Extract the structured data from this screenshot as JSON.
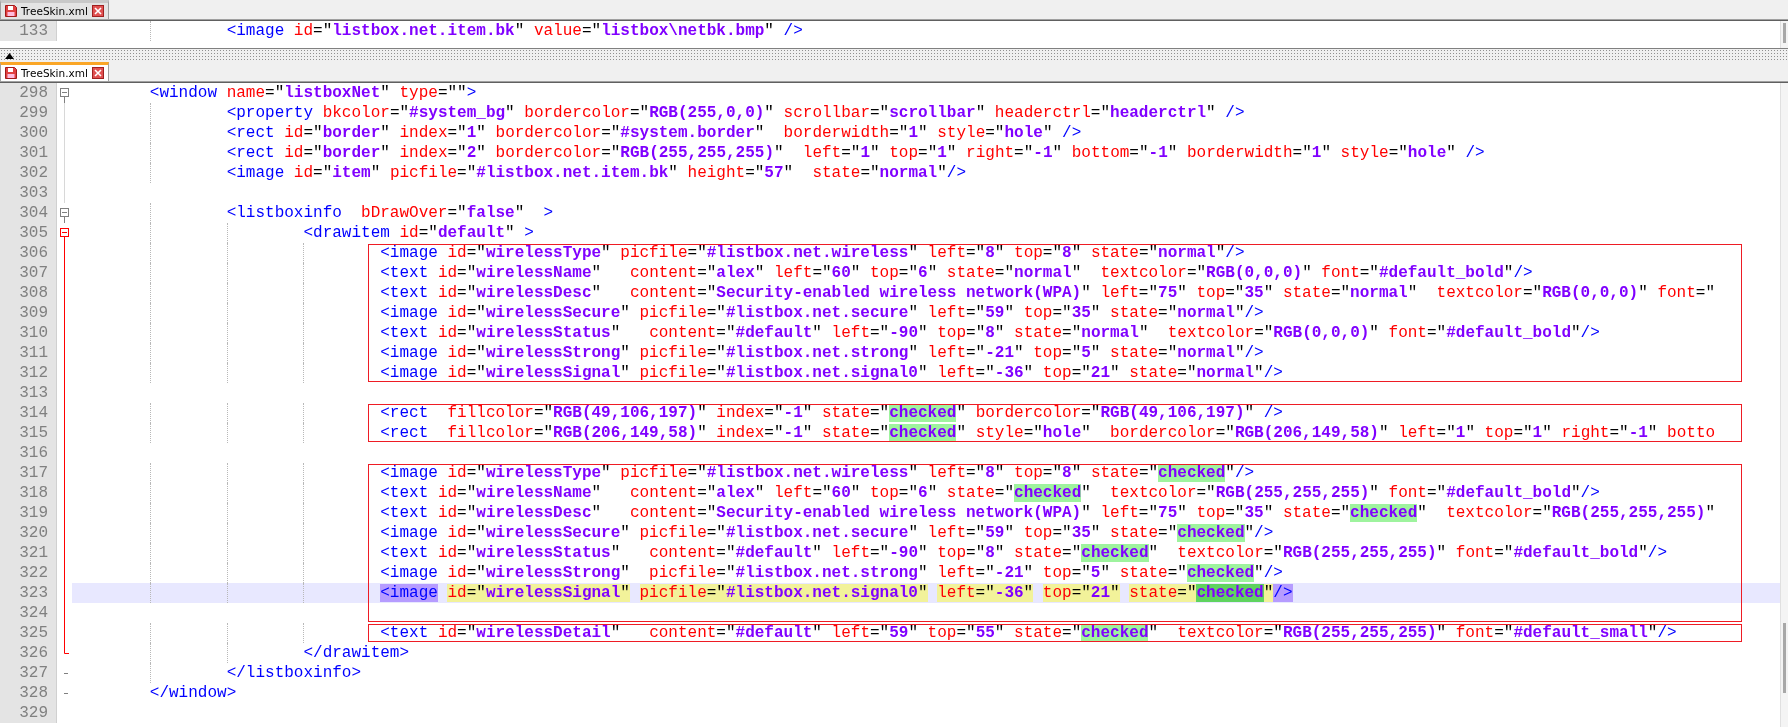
{
  "editors": [
    {
      "tab": {
        "label": "TreeSkin.xml",
        "selected": false
      },
      "blocks": [
        {
          "boxed": false,
          "lines": [
            {
              "number": "133",
              "current": false,
              "kind": "plain",
              "parts": [
                "\t\t<image id=\"listbox.net.item.bk\" value=\"listbox\\netbk.bmp\" />"
              ]
            }
          ]
        }
      ]
    },
    {
      "tab": {
        "label": "TreeSkin.xml",
        "selected": true
      },
      "blocks": [
        {
          "boxed": false,
          "lines": [
            {
              "number": "298",
              "current": false,
              "kind": "open",
              "fold_active": false,
              "parts": [
                "\t<window name=\"listboxNet\" type=\"\">"
              ]
            },
            {
              "number": "299",
              "current": false,
              "kind": "body",
              "fold_active": false,
              "parts": [
                "\t\t<property bkcolor=\"#system_bg\" bordercolor=\"RGB(255,0,0)\" scrollbar=\"scrollbar\" headerctrl=\"headerctrl\" />"
              ]
            },
            {
              "number": "300",
              "current": false,
              "kind": "body",
              "fold_active": false,
              "parts": [
                "\t\t<rect id=\"border\" index=\"1\" bordercolor=\"#system.border\"  borderwidth=\"1\" style=\"hole\" />"
              ]
            },
            {
              "number": "301",
              "current": false,
              "kind": "body",
              "fold_active": false,
              "parts": [
                "\t\t<rect id=\"border\" index=\"2\" bordercolor=\"RGB(255,255,255)\"  left=\"1\" top=\"1\" right=\"-1\" bottom=\"-1\" borderwidth=\"1\" style=\"hole\" />"
              ]
            },
            {
              "number": "302",
              "current": false,
              "kind": "body",
              "fold_active": false,
              "parts": [
                "\t\t<image id=\"item\" picfile=\"#listbox.net.item.bk\" height=\"57\"  state=\"normal\"/>"
              ]
            },
            {
              "number": "303",
              "current": false,
              "kind": "body",
              "fold_active": false
            },
            {
              "number": "304",
              "current": false,
              "kind": "open",
              "fold_active": false,
              "parts": [
                "\t\t<listboxinfo  bDrawOver=\"false\"  >"
              ]
            },
            {
              "number": "305",
              "current": false,
              "kind": "open",
              "fold_active": true,
              "parts": [
                "\t\t\t<drawitem id=\"default\" >"
              ]
            }
          ]
        },
        {
          "boxed": true,
          "lines": [
            {
              "number": "306",
              "current": false,
              "kind": "body",
              "fold_active": true,
              "parts": [
                "\t\t\t\t<image id=\"wirelessType\" picfile=\"#listbox.net.wireless\" left=\"8\" top=\"8\" state=\"normal\"/>"
              ]
            },
            {
              "number": "307",
              "current": false,
              "kind": "body",
              "fold_active": true,
              "parts": [
                "\t\t\t\t<text id=\"wirelessName\"   content=\"alex\" left=\"60\" top=\"6\" state=\"normal\"  textcolor=\"RGB(0,0,0)\" font=\"#default_bold\"/>"
              ]
            },
            {
              "number": "308",
              "current": false,
              "kind": "body",
              "fold_active": true,
              "parts": [
                "\t\t\t\t<text id=\"wirelessDesc\"   content=\"Security-enabled wireless network(WPA)\" left=\"75\" top=\"35\" state=\"normal\"  textcolor=\"RGB(0,0,0)\" font=\""
              ]
            },
            {
              "number": "309",
              "current": false,
              "kind": "body",
              "fold_active": true,
              "parts": [
                "\t\t\t\t<image id=\"wirelessSecure\" picfile=\"#listbox.net.secure\" left=\"59\" top=\"35\" state=\"normal\"/>"
              ]
            },
            {
              "number": "310",
              "current": false,
              "kind": "body",
              "fold_active": true,
              "parts": [
                "\t\t\t\t<text id=\"wirelessStatus\"   content=\"#default\" left=\"-90\" top=\"8\" state=\"normal\"  textcolor=\"RGB(0,0,0)\" font=\"#default_bold\"/>"
              ]
            },
            {
              "number": "311",
              "current": false,
              "kind": "body",
              "fold_active": true,
              "parts": [
                "\t\t\t\t<image id=\"wirelessStrong\" picfile=\"#listbox.net.strong\" left=\"-21\" top=\"5\" state=\"normal\"/>"
              ]
            },
            {
              "number": "312",
              "current": false,
              "kind": "body",
              "fold_active": true,
              "parts": [
                "\t\t\t\t<image id=\"wirelessSignal\" picfile=\"#listbox.net.signal0\" left=\"-36\" top=\"21\" state=\"normal\"/>"
              ]
            }
          ]
        },
        {
          "boxed": false,
          "lines": [
            {
              "number": "313",
              "current": false,
              "kind": "body",
              "fold_active": true
            }
          ]
        },
        {
          "boxed": true,
          "lines": [
            {
              "number": "314",
              "current": false,
              "kind": "body",
              "fold_active": true,
              "parts": [
                "\t\t\t\t<rect  fillcolor=\"RGB(49,106,197)\" index=\"-1\" state=\"",
                {
                  "text": "checked",
                  "kind": "match"
                },
                "\" bordercolor=\"RGB(49,106,197)\" />"
              ]
            },
            {
              "number": "315",
              "current": false,
              "kind": "body",
              "fold_active": true,
              "parts": [
                "\t\t\t\t<rect  fillcolor=\"RGB(206,149,58)\" index=\"-1\" state=\"",
                {
                  "text": "checked",
                  "kind": "match"
                },
                "\" style=\"hole\"  bordercolor=\"RGB(206,149,58)\" left=\"1\" top=\"1\" right=\"-1\" botto"
              ]
            }
          ]
        },
        {
          "boxed": false,
          "lines": [
            {
              "number": "316",
              "current": false,
              "kind": "body",
              "fold_active": true
            }
          ]
        },
        {
          "boxed": true,
          "lines": [
            {
              "number": "317",
              "current": false,
              "kind": "body",
              "fold_active": true,
              "parts": [
                "\t\t\t\t<image id=\"wirelessType\" picfile=\"#listbox.net.wireless\" left=\"8\" top=\"8\" state=\"",
                {
                  "text": "checked",
                  "kind": "match"
                },
                "\"/>"
              ]
            },
            {
              "number": "318",
              "current": false,
              "kind": "body",
              "fold_active": true,
              "parts": [
                "\t\t\t\t<text id=\"wirelessName\"   content=\"alex\" left=\"60\" top=\"6\" state=\"",
                {
                  "text": "checked",
                  "kind": "match"
                },
                "\"  textcolor=\"RGB(255,255,255)\" font=\"#default_bold\"/>"
              ]
            },
            {
              "number": "319",
              "current": false,
              "kind": "body",
              "fold_active": true,
              "parts": [
                "\t\t\t\t<text id=\"wirelessDesc\"   content=\"Security-enabled wireless network(WPA)\" left=\"75\" top=\"35\" state=\"",
                {
                  "text": "checked",
                  "kind": "match"
                },
                "\"  textcolor=\"RGB(255,255,255)\""
              ]
            },
            {
              "number": "320",
              "current": false,
              "kind": "body",
              "fold_active": true,
              "parts": [
                "\t\t\t\t<image id=\"wirelessSecure\" picfile=\"#listbox.net.secure\" left=\"59\" top=\"35\" state=\"",
                {
                  "text": "checked",
                  "kind": "match"
                },
                "\"/>"
              ]
            },
            {
              "number": "321",
              "current": false,
              "kind": "body",
              "fold_active": true,
              "parts": [
                "\t\t\t\t<text id=\"wirelessStatus\"   content=\"#default\" left=\"-90\" top=\"8\" state=\"",
                {
                  "text": "checked",
                  "kind": "match"
                },
                "\"  textcolor=\"RGB(255,255,255)\" font=\"#default_bold\"/>"
              ]
            },
            {
              "number": "322",
              "current": false,
              "kind": "body",
              "fold_active": true,
              "parts": [
                "\t\t\t\t<image id=\"wirelessStrong\"  picfile=\"#listbox.net.strong\" left=\"-21\" top=\"5\" state=\"",
                {
                  "text": "checked",
                  "kind": "match"
                },
                "\"/>"
              ]
            },
            {
              "number": "323",
              "current": true,
              "kind": "body",
              "fold_active": true,
              "parts": [
                {
                  "text": "\t\t\t\t<image",
                  "kind": "tag"
                },
                {
                  "text": " id=\"wirelessSignal\"",
                  "kind": "mark"
                },
                {
                  "text": " picfile=\"#listbox.net.signal0\"",
                  "kind": "mark"
                },
                {
                  "text": " left=\"-36\"",
                  "kind": "mark"
                },
                {
                  "text": " top=\"21\"",
                  "kind": "mark"
                },
                {
                  "text": " state=\"",
                  "kind": "mark"
                },
                {
                  "text": "checked",
                  "kind": "current"
                },
                {
                  "text": "\"",
                  "kind": "mark"
                },
                {
                  "text": "/>",
                  "kind": "tag"
                }
              ]
            },
            {
              "number": "324",
              "current": false,
              "kind": "body",
              "fold_active": true
            }
          ]
        },
        {
          "boxed": true,
          "lines": [
            {
              "number": "325",
              "current": false,
              "kind": "body",
              "fold_active": true,
              "parts": [
                "\t\t\t\t<text id=\"wirelessDetail\"   content=\"#default\" left=\"59\" top=\"55\" state=\"",
                {
                  "text": "checked",
                  "kind": "match"
                },
                "\"  textcolor=\"RGB(255,255,255)\" font=\"#default_small\"/>"
              ]
            }
          ]
        },
        {
          "boxed": false,
          "lines": [
            {
              "number": "326",
              "current": false,
              "kind": "end",
              "fold_active": true,
              "parts": [
                "\t\t\t</drawitem>"
              ]
            },
            {
              "number": "327",
              "current": false,
              "kind": "end",
              "fold_active": false,
              "parts": [
                "\t\t</listboxinfo>"
              ]
            },
            {
              "number": "328",
              "current": false,
              "kind": "end",
              "fold_active": false,
              "parts": [
                "\t</window>"
              ]
            },
            {
              "number": "329",
              "current": false,
              "kind": "plain"
            }
          ]
        }
      ]
    }
  ]
}
